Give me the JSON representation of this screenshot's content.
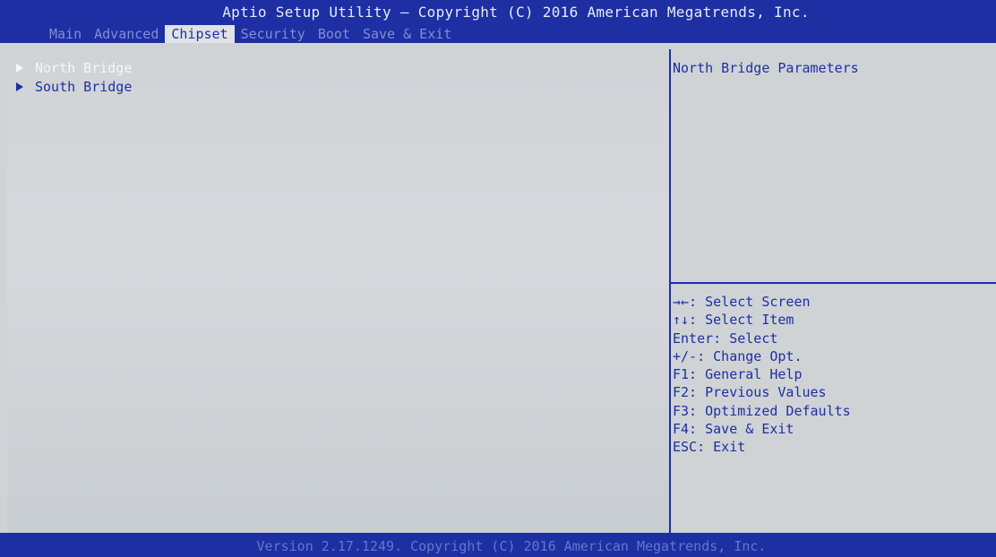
{
  "header": {
    "title": "Aptio Setup Utility – Copyright (C) 2016 American Megatrends, Inc.",
    "tabs": [
      {
        "label": "Main",
        "active": false
      },
      {
        "label": "Advanced",
        "active": false
      },
      {
        "label": "Chipset",
        "active": true
      },
      {
        "label": "Security",
        "active": false
      },
      {
        "label": "Boot",
        "active": false
      },
      {
        "label": "Save & Exit",
        "active": false
      }
    ]
  },
  "main": {
    "items": [
      {
        "label": "North Bridge",
        "icon": "submenu-arrow-icon",
        "selected": true
      },
      {
        "label": "South Bridge",
        "icon": "submenu-arrow-icon",
        "selected": false
      }
    ]
  },
  "help": {
    "description": "North Bridge Parameters",
    "keys": [
      "→←: Select Screen",
      "↑↓: Select Item",
      "Enter: Select",
      "+/-: Change Opt.",
      "F1: General Help",
      "F2: Previous Values",
      "F3: Optimized Defaults",
      "F4: Save & Exit",
      "ESC: Exit"
    ]
  },
  "footer": {
    "text": "Version 2.17.1249. Copyright (C) 2016 American Megatrends, Inc."
  },
  "colors": {
    "primary_blue": "#1d2fa3",
    "panel_gray": "#cfd3d6",
    "selected_text": "#f4f6fa",
    "inactive_tab": "#7f8fd6"
  }
}
